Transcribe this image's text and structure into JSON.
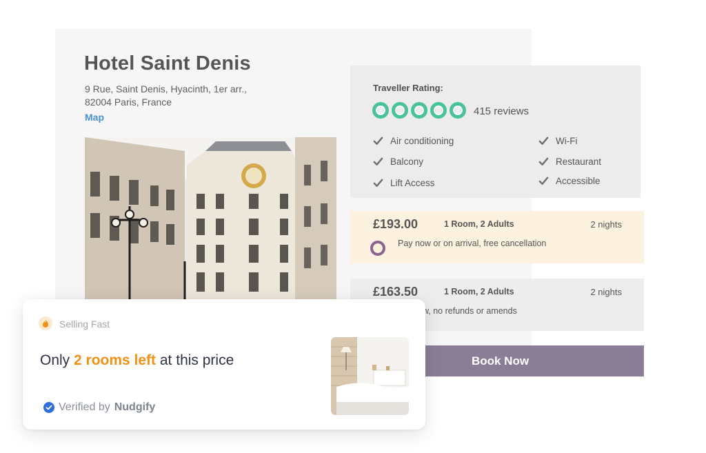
{
  "hotel": {
    "name": "Hotel Saint Denis",
    "address_line1": "9 Rue, Saint Denis, Hyacinth, 1er arr.,",
    "address_line2": "82004 Paris, France",
    "map_link": "Map"
  },
  "rating": {
    "label": "Traveller Rating:",
    "score_out_of_5": 5,
    "reviews": "415 reviews",
    "color": "#48c29a"
  },
  "amenities": [
    "Air conditioning",
    "Wi-Fi",
    "Balcony",
    "Restaurant",
    "Lift Access",
    "Accessible"
  ],
  "options": [
    {
      "price": "£193.00",
      "rooms": "1 Room, 2 Adults",
      "nights": "2 nights",
      "note": "Pay now or on arrival, free cancellation",
      "selected": true
    },
    {
      "price": "£163.50",
      "rooms": "1 Room, 2 Adults",
      "nights": "2 nights",
      "note": "ow, no refunds or amends",
      "selected": false
    }
  ],
  "book_button": "Book Now",
  "nudge": {
    "tag": "Selling Fast",
    "msg_prefix": "Only ",
    "msg_highlight": "2 rooms left",
    "msg_suffix": " at this price",
    "verified_prefix": "Verified by",
    "brand": "Nudgify",
    "highlight_color": "#f19217"
  },
  "colors": {
    "accent_purple": "#8a7e96",
    "radio_purple": "#8a648f",
    "link_blue": "#4a8fd8",
    "selected_option_bg": "#fdf2df"
  }
}
